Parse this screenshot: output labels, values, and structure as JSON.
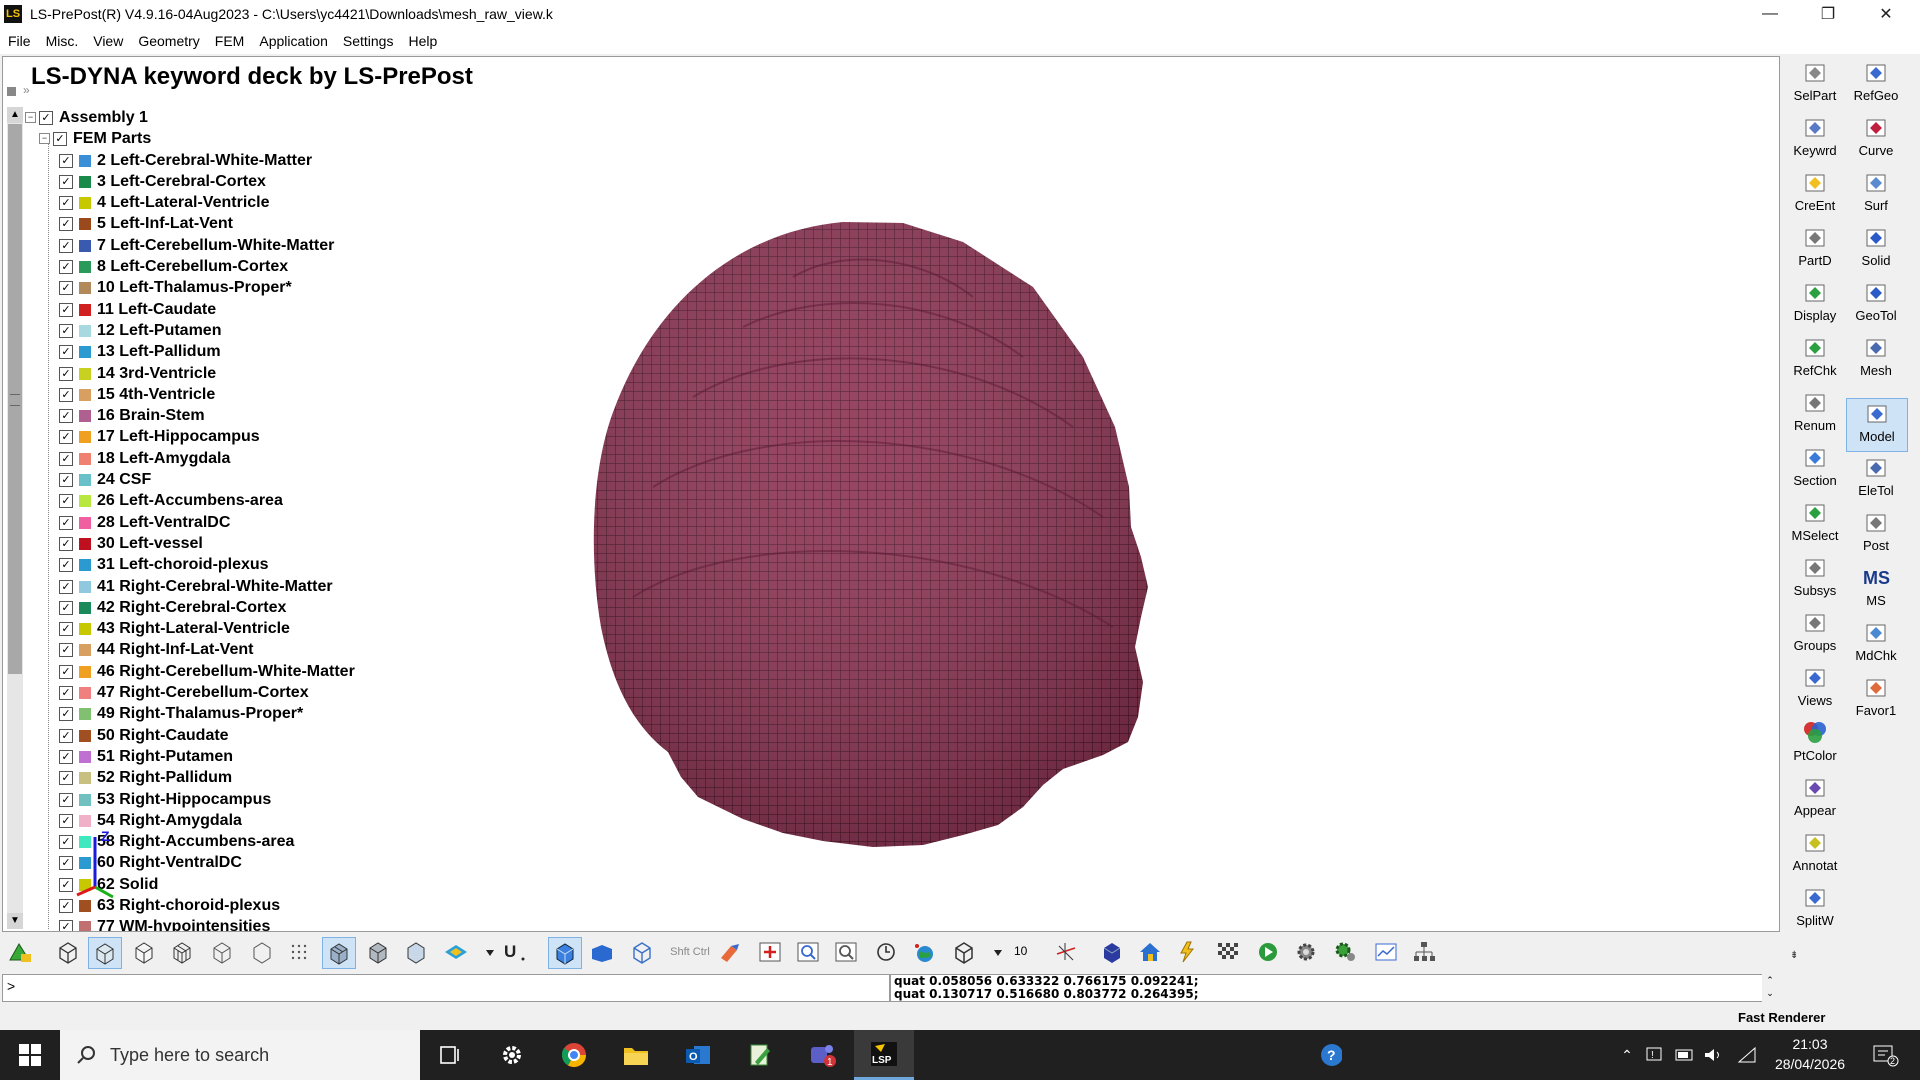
{
  "window": {
    "title": "LS-PrePost(R) V4.9.16-04Aug2023 - C:\\Users\\yc4421\\Downloads\\mesh_raw_view.k",
    "logo_text": "LS",
    "min": "—",
    "max": "❐",
    "close": "✕"
  },
  "menu": [
    "File",
    "Misc.",
    "View",
    "Geometry",
    "FEM",
    "Application",
    "Settings",
    "Help"
  ],
  "panel": {
    "title": "LS-DYNA keyword deck by LS-PrePost"
  },
  "tree": {
    "assembly": "Assembly 1",
    "group": "FEM Parts",
    "check": "✓",
    "parts": [
      {
        "label": "2 Left-Cerebral-White-Matter",
        "color": "#3a8fd6"
      },
      {
        "label": "3 Left-Cerebral-Cortex",
        "color": "#1a8a4a"
      },
      {
        "label": "4 Left-Lateral-Ventricle",
        "color": "#c8c800"
      },
      {
        "label": "5 Left-Inf-Lat-Vent",
        "color": "#9a4a1a"
      },
      {
        "label": "7 Left-Cerebellum-White-Matter",
        "color": "#3a5ab0"
      },
      {
        "label": "8 Left-Cerebellum-Cortex",
        "color": "#2a9a5a"
      },
      {
        "label": "10 Left-Thalamus-Proper*",
        "color": "#b08a5a"
      },
      {
        "label": "11 Left-Caudate",
        "color": "#d02020"
      },
      {
        "label": "12 Left-Putamen",
        "color": "#a8d8e0"
      },
      {
        "label": "13 Left-Pallidum",
        "color": "#2a9ad0"
      },
      {
        "label": "14 3rd-Ventricle",
        "color": "#c8d020"
      },
      {
        "label": "15 4th-Ventricle",
        "color": "#d8a060"
      },
      {
        "label": "16 Brain-Stem",
        "color": "#b06090"
      },
      {
        "label": "17 Left-Hippocampus",
        "color": "#f0a020"
      },
      {
        "label": "18 Left-Amygdala",
        "color": "#f08070"
      },
      {
        "label": "24 CSF",
        "color": "#6ac0c8"
      },
      {
        "label": "26 Left-Accumbens-area",
        "color": "#b8e840"
      },
      {
        "label": "28 Left-VentralDC",
        "color": "#f060a0"
      },
      {
        "label": "30 Left-vessel",
        "color": "#c01020"
      },
      {
        "label": "31 Left-choroid-plexus",
        "color": "#2a9ad0"
      },
      {
        "label": "41 Right-Cerebral-White-Matter",
        "color": "#90c8e0"
      },
      {
        "label": "42 Right-Cerebral-Cortex",
        "color": "#1a8a5a"
      },
      {
        "label": "43 Right-Lateral-Ventricle",
        "color": "#c8c800"
      },
      {
        "label": "44 Right-Inf-Lat-Vent",
        "color": "#d8a060"
      },
      {
        "label": "46 Right-Cerebellum-White-Matter",
        "color": "#f0a020"
      },
      {
        "label": "47 Right-Cerebellum-Cortex",
        "color": "#f08080"
      },
      {
        "label": "49 Right-Thalamus-Proper*",
        "color": "#80c070"
      },
      {
        "label": "50 Right-Caudate",
        "color": "#a05020"
      },
      {
        "label": "51 Right-Putamen",
        "color": "#c070d0"
      },
      {
        "label": "52 Right-Pallidum",
        "color": "#c8c080"
      },
      {
        "label": "53 Right-Hippocampus",
        "color": "#70c0c0"
      },
      {
        "label": "54 Right-Amygdala",
        "color": "#f0b0c8"
      },
      {
        "label": "58 Right-Accumbens-area",
        "color": "#40e8c0"
      },
      {
        "label": "60 Right-VentralDC",
        "color": "#2a9ad0"
      },
      {
        "label": "62 Solid",
        "color": "#c8c800"
      },
      {
        "label": "63 Right-choroid-plexus",
        "color": "#a05020"
      },
      {
        "label": "77 WM-hypointensities",
        "color": "#c07070"
      }
    ]
  },
  "mesh": {
    "color": "#8e3554",
    "line_color": "#4a1428"
  },
  "triad": {
    "z": "Z"
  },
  "right_toolbar": [
    {
      "label": "SelPart",
      "icon": "gear-icon"
    },
    {
      "label": "RefGeo",
      "icon": "refgeo-icon"
    },
    {
      "label": "Keywrd",
      "icon": "keyword-icon"
    },
    {
      "label": "Curve",
      "icon": "curve-icon"
    },
    {
      "label": "CreEnt",
      "icon": "create-entity-icon"
    },
    {
      "label": "Surf",
      "icon": "surface-icon"
    },
    {
      "label": "PartD",
      "icon": "part-data-icon"
    },
    {
      "label": "Solid",
      "icon": "solid-icon"
    },
    {
      "label": "Display",
      "icon": "display-icon"
    },
    {
      "label": "GeoTol",
      "icon": "geotol-icon"
    },
    {
      "label": "RefChk",
      "icon": "refcheck-icon"
    },
    {
      "label": "Mesh",
      "icon": "mesh-icon"
    },
    {
      "label": "Renum",
      "icon": "renumber-icon"
    },
    {
      "label": "Model",
      "icon": "model-icon"
    },
    {
      "label": "Section",
      "icon": "section-icon"
    },
    {
      "label": "EleTol",
      "icon": "eletol-icon"
    },
    {
      "label": "MSelect",
      "icon": "mselect-icon"
    },
    {
      "label": "Post",
      "icon": "post-icon"
    },
    {
      "label": "Subsys",
      "icon": "subsystem-icon"
    },
    {
      "label": "MS",
      "icon": "ms-icon"
    },
    {
      "label": "Groups",
      "icon": "groups-icon"
    },
    {
      "label": "MdChk",
      "icon": "model-check-icon"
    },
    {
      "label": "Views",
      "icon": "views-icon"
    },
    {
      "label": "Favor1",
      "icon": "favorite-icon"
    },
    {
      "label": "PtColor",
      "icon": "part-color-icon"
    },
    {
      "label": "Appear",
      "icon": "appearance-icon"
    },
    {
      "label": "Annotat",
      "icon": "annotation-icon"
    },
    {
      "label": "SplitW",
      "icon": "split-window-icon"
    }
  ],
  "bottom_toolbar": {
    "number": "10",
    "shift_ctrl": "Shft Ctrl"
  },
  "command": {
    "prompt": ">"
  },
  "messages": [
    "quat 0.058056 0.633322 0.766175 0.092241;",
    "quat 0.130717 0.516680 0.803772 0.264395;"
  ],
  "status": {
    "renderer": "Fast Renderer"
  },
  "taskbar": {
    "search_placeholder": "Type here to search",
    "time": "21:03",
    "date": "28/04/2026",
    "teams_badge": "1",
    "notify_badge": "2",
    "lsp_label": "LSP"
  }
}
